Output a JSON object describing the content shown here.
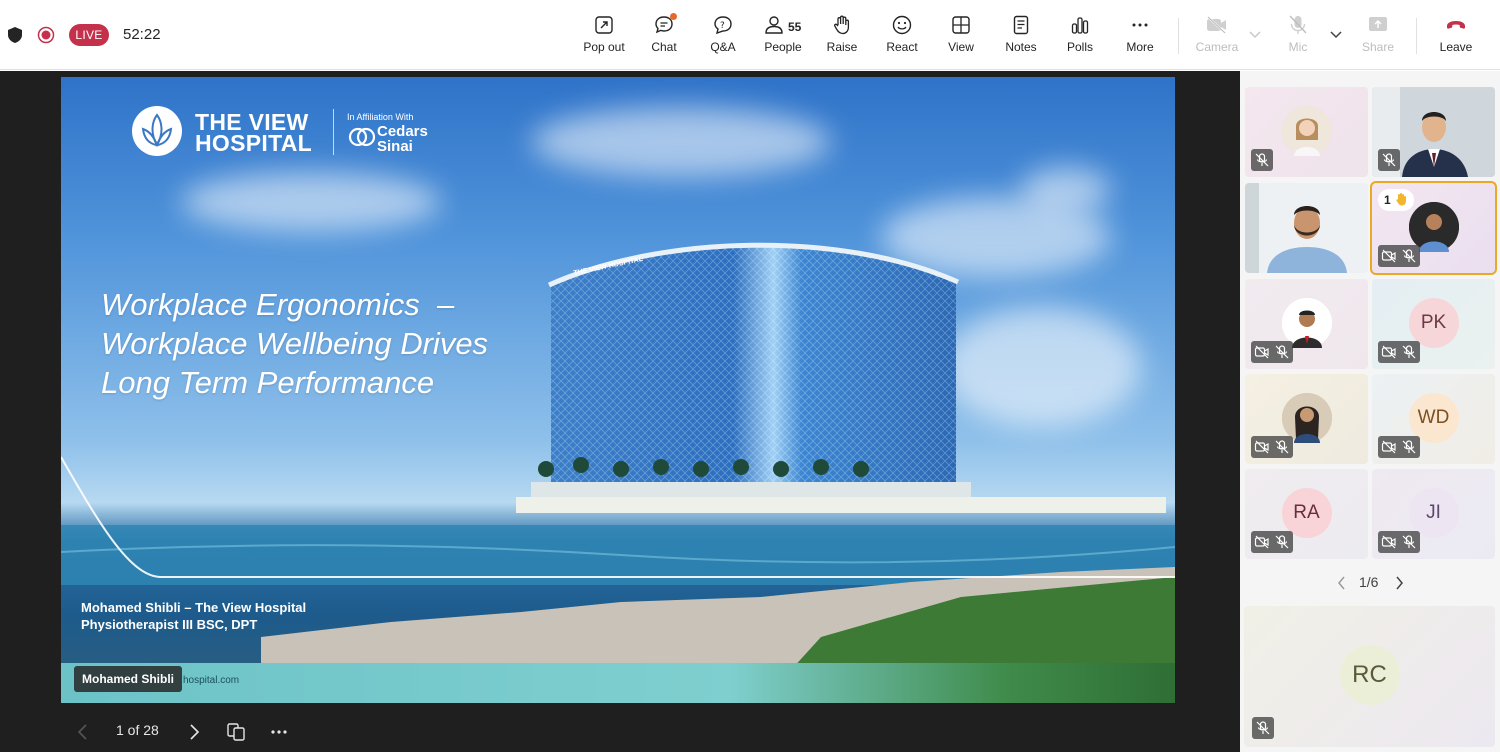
{
  "topbar": {
    "live_label": "LIVE",
    "timer": "52:22",
    "buttons": {
      "popout": "Pop out",
      "chat": "Chat",
      "qa": "Q&A",
      "people": "People",
      "people_count": "55",
      "raise": "Raise",
      "react": "React",
      "view": "View",
      "notes": "Notes",
      "polls": "Polls",
      "more": "More",
      "camera": "Camera",
      "mic": "Mic",
      "share": "Share",
      "leave": "Leave"
    },
    "colors": {
      "live": "#c4314b",
      "leave": "#c4314b",
      "chat_dot": "#e8672a"
    }
  },
  "slide": {
    "logo_text_line1": "THE VIEW",
    "logo_text_line2": "HOSPITAL",
    "affiliation": "In Affiliation With",
    "partner_line1": "Cedars",
    "partner_line2": "Sinai",
    "title_line1": "Workplace Ergonomics  –",
    "title_line2": "Workplace Wellbeing Drives",
    "title_line3": "Long Term Performance",
    "presenter_line1": "Mohamed Shibli – The View Hospital",
    "presenter_line2": "Physiotherapist III BSC, DPT",
    "footer_url": "hospital.com",
    "building_sign": "THE VIEW HOSPITAL"
  },
  "presenter_tag": "Mohamed Shibli",
  "slide_nav": {
    "page": "1 of 28"
  },
  "gallery": {
    "tiles": [
      {
        "initials": "",
        "kind": "photo"
      },
      {
        "initials": "",
        "kind": "video"
      },
      {
        "initials": "",
        "kind": "video"
      },
      {
        "initials": "",
        "kind": "photo",
        "hand_count": "1"
      },
      {
        "initials": "",
        "kind": "photo"
      },
      {
        "initials": "PK",
        "kind": "initials"
      },
      {
        "initials": "",
        "kind": "photo"
      },
      {
        "initials": "WD",
        "kind": "initials"
      },
      {
        "initials": "RA",
        "kind": "initials"
      },
      {
        "initials": "JI",
        "kind": "initials"
      }
    ],
    "page": "1/6",
    "big_tile_initials": "RC"
  }
}
